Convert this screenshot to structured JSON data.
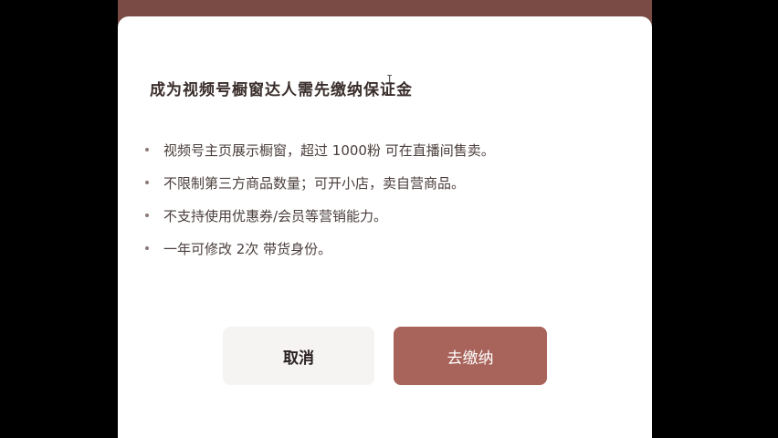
{
  "modal": {
    "title": "成为视频号橱窗达人需先缴纳保证金",
    "bullets": [
      "视频号主页展示橱窗，超过 1000粉 可在直播间售卖。",
      "不限制第三方商品数量；可开小店，卖自营商品。",
      "不支持使用优惠券/会员等营销能力。",
      "一年可修改 2次 带货身份。"
    ],
    "cancel_label": "取消",
    "pay_label": "去缴纳"
  },
  "colors": {
    "backdrop": "#7a4a44",
    "primary_button": "#a8635a",
    "secondary_button": "#f6f3f3"
  },
  "icons": {
    "cursor": "text-cursor-icon"
  }
}
